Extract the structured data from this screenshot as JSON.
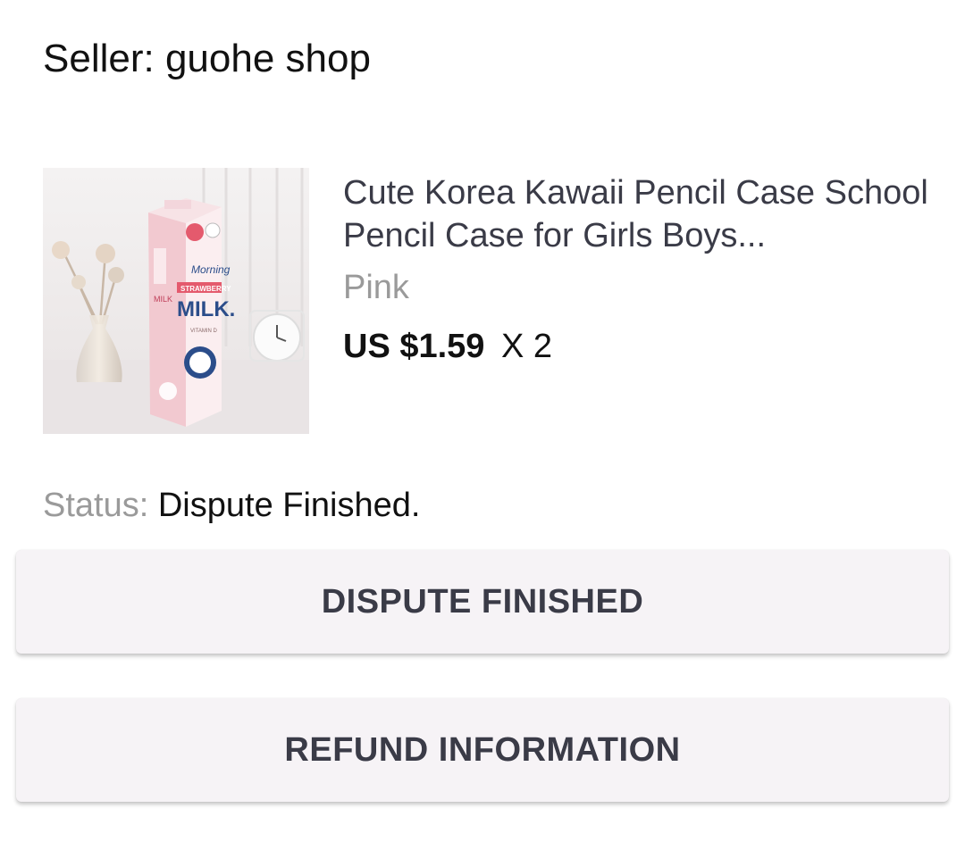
{
  "seller": {
    "label": "Seller: guohe shop"
  },
  "product": {
    "image_icon": "milk-carton-pencil-case-photo",
    "title": "Cute Korea Kawaii Pencil Case School Pencil Case for Girls Boys...",
    "variant": "Pink",
    "price": "US $1.59",
    "quantity": "X 2"
  },
  "status": {
    "label": "Status:",
    "value": "Dispute Finished."
  },
  "buttons": {
    "dispute_finished": "DISPUTE FINISHED",
    "refund_information": "REFUND INFORMATION"
  },
  "colors": {
    "button_bg": "#f6f3f6",
    "button_text": "#3a3b47",
    "muted_text": "#9a9a9a"
  }
}
